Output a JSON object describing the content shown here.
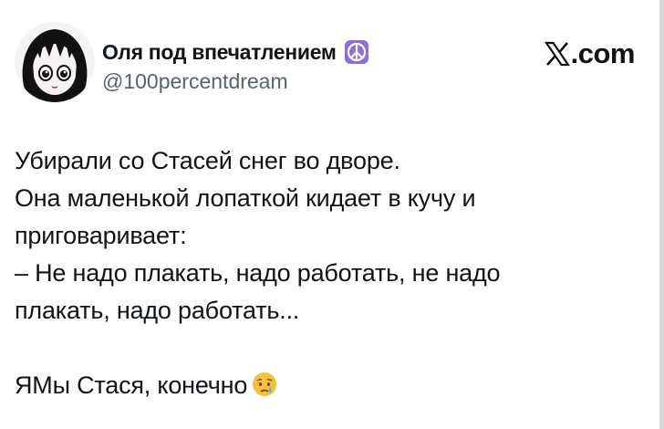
{
  "author": {
    "display_name": "Оля под впечатлением",
    "handle": "@100percentdream",
    "name_icon": "peace-symbol-icon",
    "avatar": "gothic-anime-girl-avatar"
  },
  "brand": {
    "icon": "x-logo-icon",
    "suffix": ".com"
  },
  "tweet": {
    "lines": [
      "Убирали со Стасей снег во дворе.",
      "Она маленькой лопаткой кидает в кучу и",
      "приговаривает:",
      "– Не надо плакать, надо работать, не надо",
      "плакать, надо работать..."
    ],
    "final_line": "ЯМы Стася, конечно",
    "final_emoji": "crying-face-icon"
  },
  "colors": {
    "text": "#0f1419",
    "secondary_text": "#536471",
    "peace_badge": "#8e6fd6",
    "emoji_yellow": "#f5c13a",
    "tear_blue": "#5ab0f0"
  }
}
